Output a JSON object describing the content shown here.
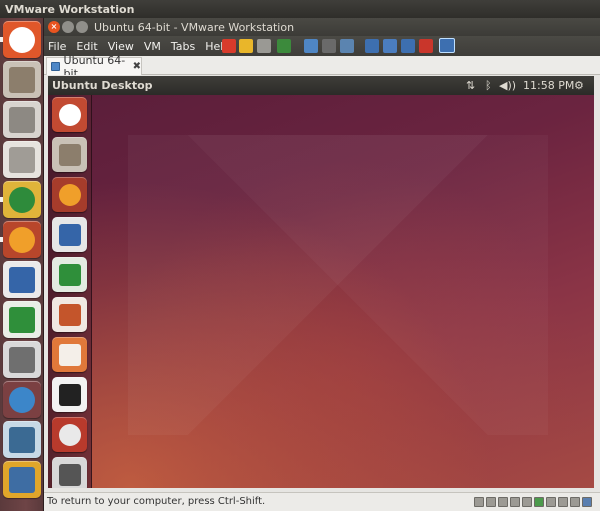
{
  "host": {
    "top_title": "VMware Workstation",
    "launcher": [
      {
        "name": "ubuntu-dash-icon",
        "bg": "#e0572a",
        "glyph": "#ffffff"
      },
      {
        "name": "files-icon",
        "bg": "#c9c1b6",
        "glyph": "#8c7e6c"
      },
      {
        "name": "drive-icon",
        "bg": "#d8d4cf",
        "glyph": "#8d8983"
      },
      {
        "name": "usb-drive-icon",
        "bg": "#e6e3de",
        "glyph": "#a09c96"
      },
      {
        "name": "chrome-icon",
        "bg": "#e0b43a",
        "glyph": "#2e8b3b"
      },
      {
        "name": "firefox-icon",
        "bg": "#b8462b",
        "glyph": "#f09f2a"
      },
      {
        "name": "writer-icon",
        "bg": "#eaeaea",
        "glyph": "#3565a8"
      },
      {
        "name": "calc-icon",
        "bg": "#e9eee6",
        "glyph": "#2f8f3a"
      },
      {
        "name": "text-editor-icon",
        "bg": "#d9d9d9",
        "glyph": "#6f6f6f"
      },
      {
        "name": "app-blue-icon",
        "bg": "#7b4042",
        "glyph": "#3c86c9"
      },
      {
        "name": "system-monitor-icon",
        "bg": "#c7d9e6",
        "glyph": "#3b6a93"
      },
      {
        "name": "vmware-icon",
        "bg": "#e0a62a",
        "glyph": "#3e6da3"
      }
    ]
  },
  "window": {
    "title": "Ubuntu 64-bit - VMware Workstation",
    "close_glyph": "×",
    "menu": [
      "File",
      "Edit",
      "View",
      "VM",
      "Tabs",
      "Help"
    ],
    "toolbar": [
      {
        "name": "power-off-icon",
        "color": "#d83b2b"
      },
      {
        "name": "suspend-icon",
        "color": "#e9b62a"
      },
      {
        "name": "play-icon",
        "color": "#9a9994"
      },
      {
        "name": "reset-icon",
        "color": "#3c8a3c"
      },
      {
        "name": "snapshot-icon",
        "color": "#4f86c4"
      },
      {
        "name": "revert-snapshot-icon",
        "color": "#6a6a6a"
      },
      {
        "name": "snapshot-manager-icon",
        "color": "#5b84b0"
      },
      {
        "name": "sidebar-view-icon",
        "color": "#3d6fb0"
      },
      {
        "name": "console-view-icon",
        "color": "#4b7dbf"
      },
      {
        "name": "thumbnail-view-icon",
        "color": "#3d6fb0"
      },
      {
        "name": "fullscreen-icon",
        "color": "#c9362b"
      },
      {
        "name": "unity-icon",
        "color": "#3d6fb0"
      }
    ]
  },
  "tab": {
    "label": "Ubuntu 64-bit",
    "close": "✖"
  },
  "guest": {
    "title": "Ubuntu Desktop",
    "indicators": {
      "network": "⇅",
      "bluetooth": "ᛒ",
      "volume": "◀))",
      "clock": "11:58 PM",
      "settings": "⚙"
    },
    "launcher": [
      {
        "name": "guest-dash-icon",
        "bg": "#c24a32",
        "glyph": "#ffffff"
      },
      {
        "name": "guest-files-icon",
        "bg": "#c9c1b6",
        "glyph": "#8c7e6c"
      },
      {
        "name": "guest-firefox-icon",
        "bg": "#a63c2b",
        "glyph": "#f09f2a"
      },
      {
        "name": "guest-writer-icon",
        "bg": "#e6e6e6",
        "glyph": "#3565a8"
      },
      {
        "name": "guest-calc-icon",
        "bg": "#e3ebe1",
        "glyph": "#2f8f3a"
      },
      {
        "name": "guest-impress-icon",
        "bg": "#f0e8e2",
        "glyph": "#c4552b"
      },
      {
        "name": "guest-software-center-icon",
        "bg": "#e0783a",
        "glyph": "#f4efe9"
      },
      {
        "name": "guest-amazon-icon",
        "bg": "#f2f2f2",
        "glyph": "#222222"
      },
      {
        "name": "guest-settings-icon",
        "bg": "#b83a2c",
        "glyph": "#e9e9e9"
      },
      {
        "name": "guest-printer-icon",
        "bg": "#d8d8d8",
        "glyph": "#555555"
      }
    ]
  },
  "status": {
    "text": "To return to your computer, press Ctrl-Shift.",
    "devices": [
      "hdd-icon",
      "cd-icon",
      "cd2-icon",
      "floppy-icon",
      "usb-icon",
      "network-status-icon",
      "sound-icon",
      "printer-status-icon",
      "display-icon",
      "message-icon"
    ]
  }
}
